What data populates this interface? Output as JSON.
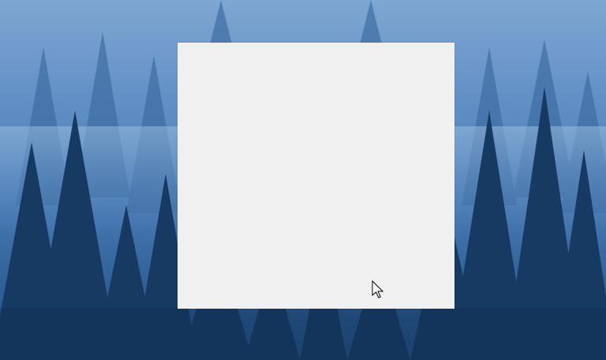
{
  "desktop": {
    "wallpaper": "misty-pine-forest",
    "colors": {
      "sky": "#7fa6d2",
      "fog": "#6b96c9",
      "trees_far": "#2e5a8c",
      "trees_near": "#163a62",
      "window_bg": "#f0f0f0"
    }
  },
  "window": {
    "state": "blank"
  },
  "cursor": {
    "icon": "arrow-pointer-icon"
  }
}
